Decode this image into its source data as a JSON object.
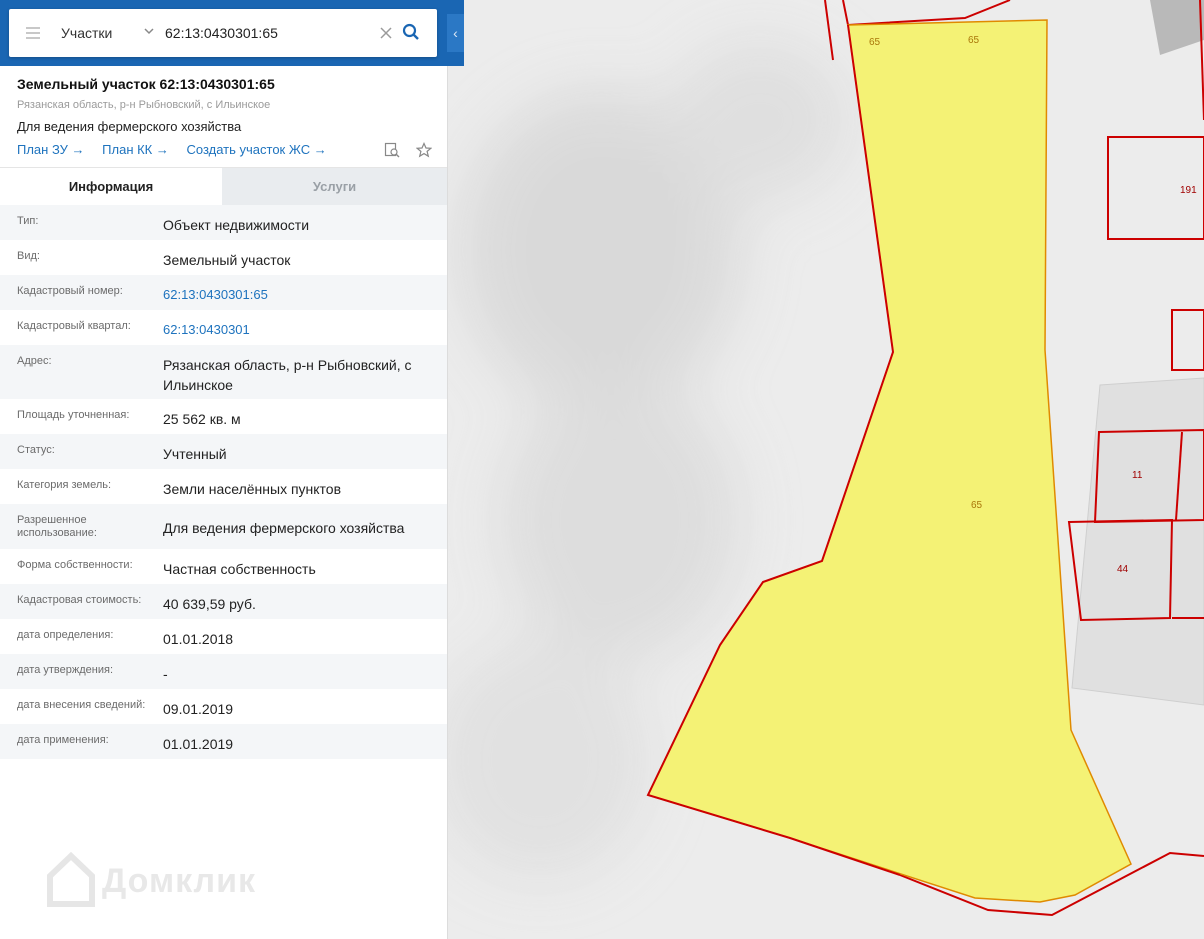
{
  "search": {
    "type_label": "Участки",
    "query": "62:13:0430301:65"
  },
  "parcel": {
    "title": "Земельный участок 62:13:0430301:65",
    "address": "Рязанская область, р-н Рыбновский, с Ильинское",
    "purpose": "Для ведения фермерского хозяйства"
  },
  "links": {
    "plan_zu": "План ЗУ →",
    "plan_kk": "План КК →",
    "create_zhs": "Создать участок ЖС →"
  },
  "tabs": {
    "info": "Информация",
    "services": "Услуги"
  },
  "rows": [
    {
      "label": "Тип:",
      "value": "Объект недвижимости"
    },
    {
      "label": "Вид:",
      "value": "Земельный участок"
    },
    {
      "label": "Кадастровый номер:",
      "value": "62:13:0430301:65"
    },
    {
      "label": "Кадастровый квартал:",
      "value": "62:13:0430301"
    },
    {
      "label": "Адрес:",
      "value": "Рязанская область, р-н Рыбновский, с Ильинское"
    },
    {
      "label": "Площадь уточненная:",
      "value": "25 562 кв. м"
    },
    {
      "label": "Статус:",
      "value": "Учтенный"
    },
    {
      "label": "Категория земель:",
      "value": "Земли населённых пунктов"
    },
    {
      "label": "Разрешенное использование:",
      "value": "Для ведения фермерского хозяйства"
    },
    {
      "label": "Форма собственности:",
      "value": "Частная собственность"
    },
    {
      "label": "Кадастровая стоимость:",
      "value": "40 639,59 руб."
    },
    {
      "label": "дата определения:",
      "value": "01.01.2018"
    },
    {
      "label": "дата утверждения:",
      "value": "-"
    },
    {
      "label": "дата внесения сведений:",
      "value": "09.01.2019"
    },
    {
      "label": "дата применения:",
      "value": "01.01.2019"
    }
  ],
  "watermark": "Домклик",
  "map_labels": {
    "parcel_65_a": "65",
    "parcel_65_b": "65",
    "parcel_65_c": "65",
    "parcel_191": "191",
    "parcel_11": "11",
    "parcel_44": "44"
  },
  "colors": {
    "header_blue": "#1a66b3",
    "link_blue": "#1e73be",
    "parcel_fill": "#f4f26f",
    "boundary_red": "#cc0000"
  }
}
